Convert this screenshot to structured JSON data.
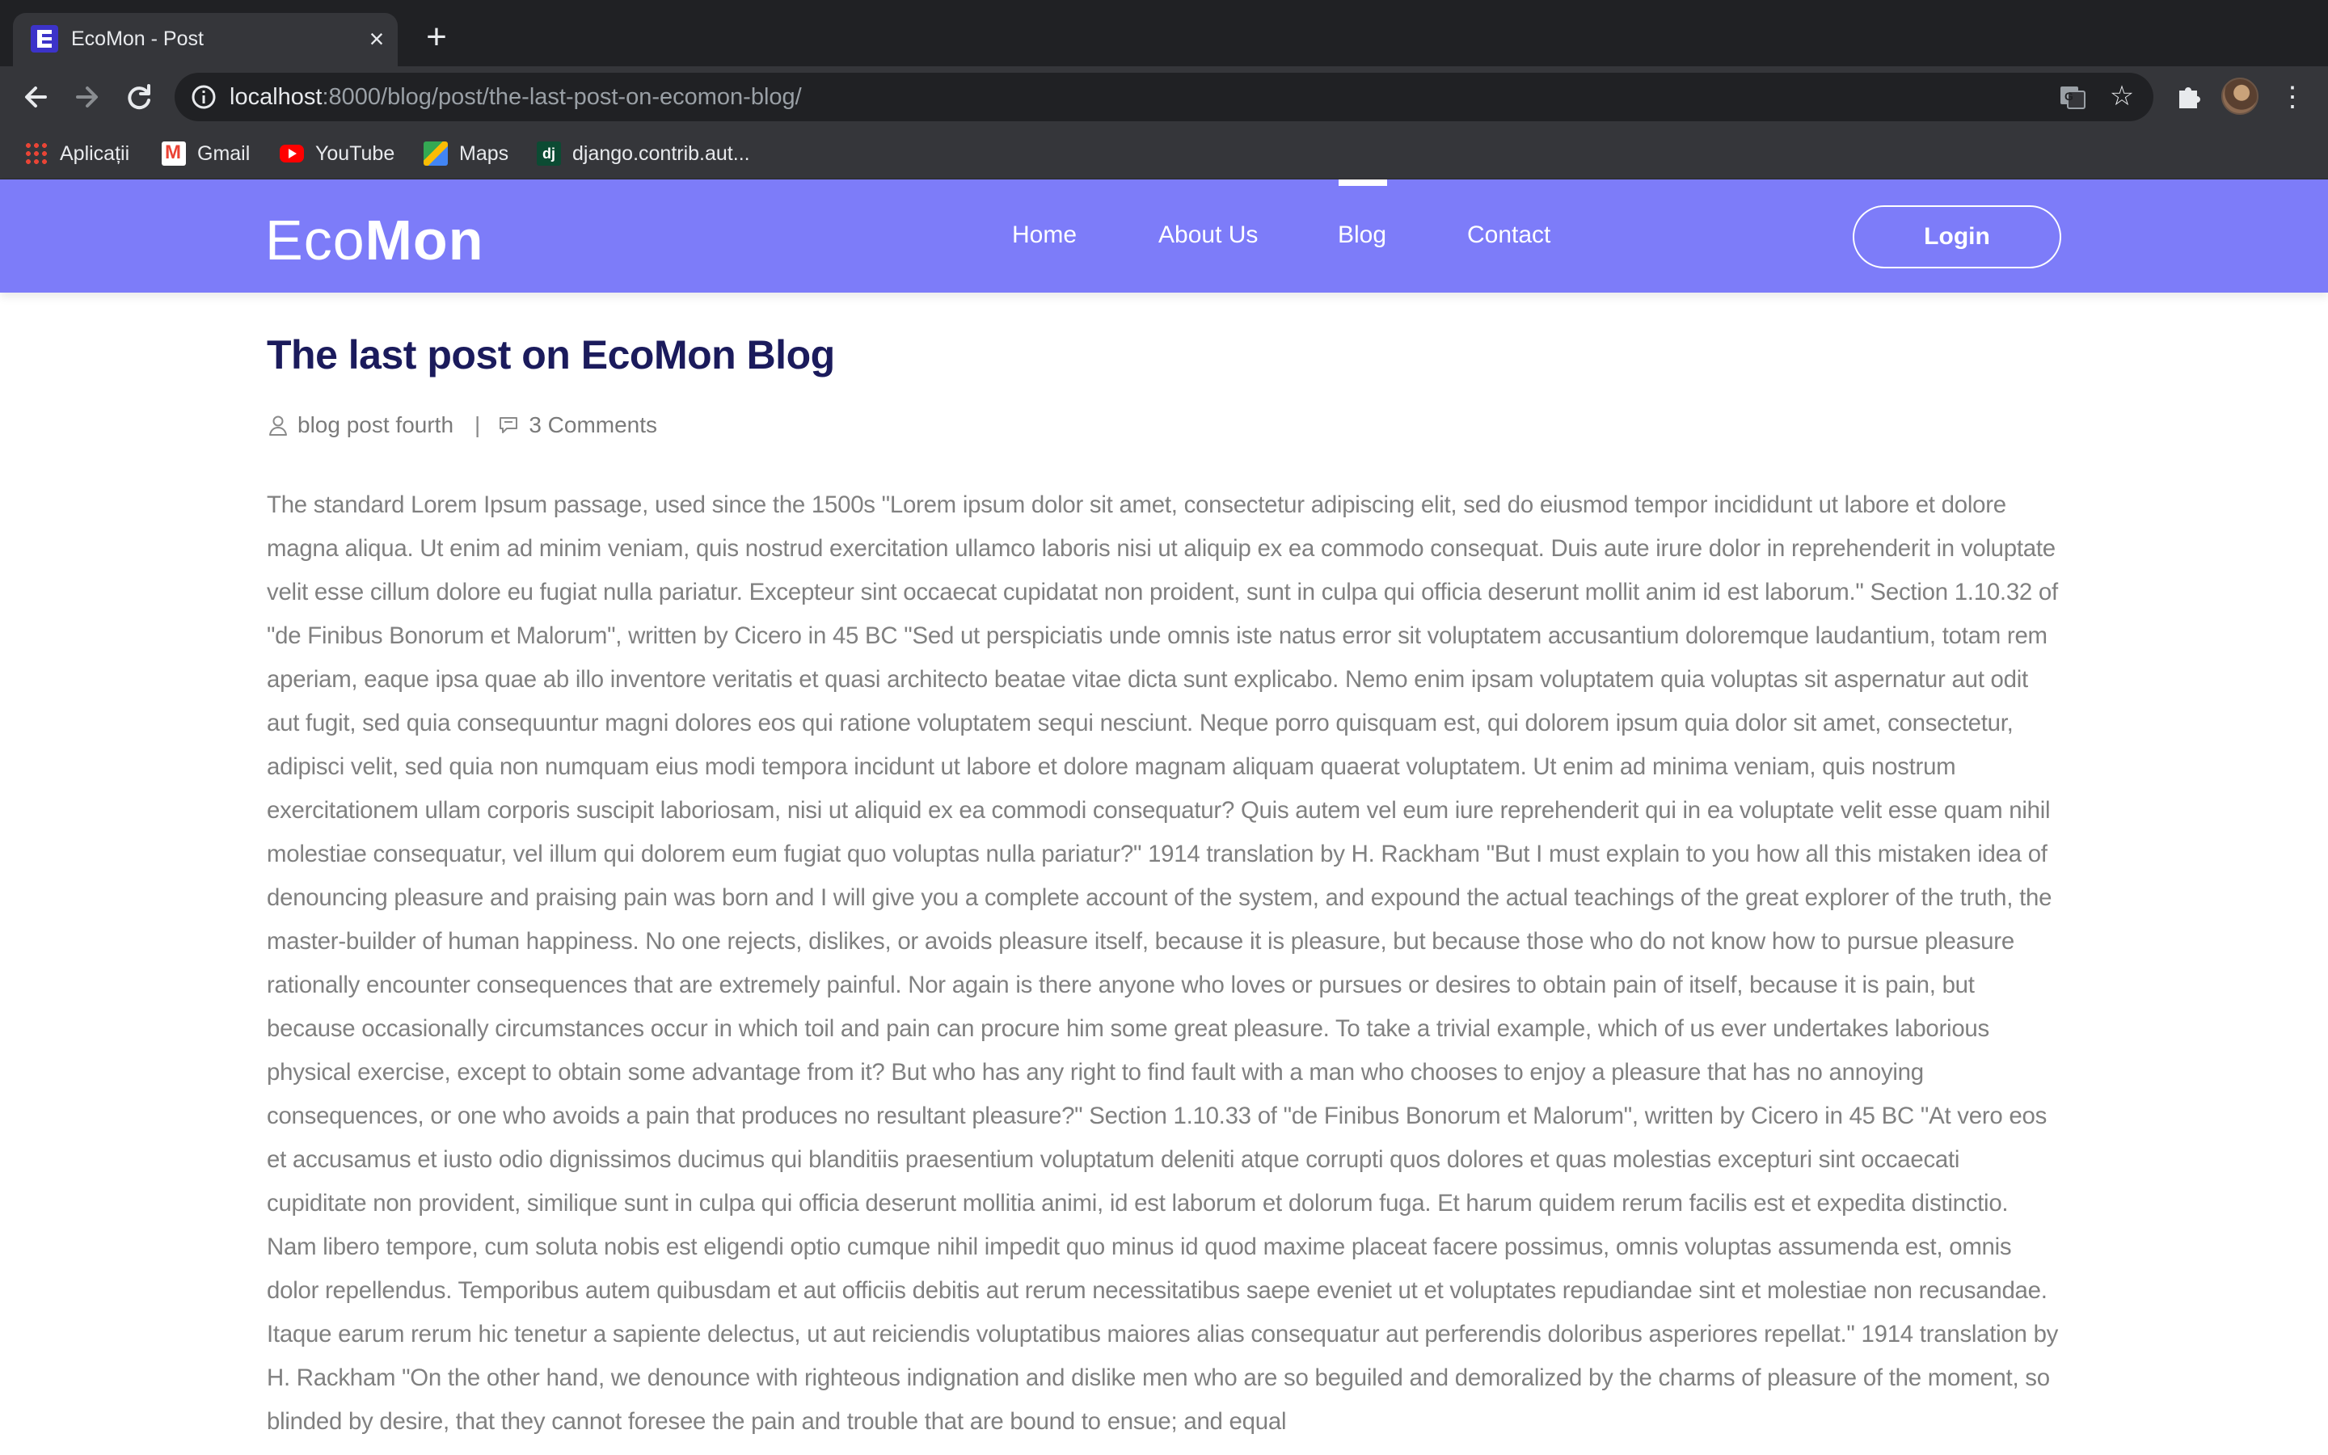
{
  "browser": {
    "tab_title": "EcoMon - Post",
    "url_host": "localhost",
    "url_rest": ":8000/blog/post/the-last-post-on-ecomon-blog/",
    "bookmarks": [
      "Aplicații",
      "Gmail",
      "YouTube",
      "Maps",
      "django.contrib.aut..."
    ]
  },
  "site": {
    "logo_part1": "Eco",
    "logo_part2": "Mon",
    "nav": [
      "Home",
      "About Us",
      "Blog",
      "Contact"
    ],
    "active_nav": "Blog",
    "login_label": "Login",
    "accent_color": "#7d7cf9"
  },
  "post": {
    "title": "The last post on EcoMon Blog",
    "author": "blog post fourth",
    "comments": "3 Comments",
    "body": "The standard Lorem Ipsum passage, used since the 1500s \"Lorem ipsum dolor sit amet, consectetur adipiscing elit, sed do eiusmod tempor incididunt ut labore et dolore magna aliqua. Ut enim ad minim veniam, quis nostrud exercitation ullamco laboris nisi ut aliquip ex ea commodo consequat. Duis aute irure dolor in reprehenderit in voluptate velit esse cillum dolore eu fugiat nulla pariatur. Excepteur sint occaecat cupidatat non proident, sunt in culpa qui officia deserunt mollit anim id est laborum.\" Section 1.10.32 of \"de Finibus Bonorum et Malorum\", written by Cicero in 45 BC \"Sed ut perspiciatis unde omnis iste natus error sit voluptatem accusantium doloremque laudantium, totam rem aperiam, eaque ipsa quae ab illo inventore veritatis et quasi architecto beatae vitae dicta sunt explicabo. Nemo enim ipsam voluptatem quia voluptas sit aspernatur aut odit aut fugit, sed quia consequuntur magni dolores eos qui ratione voluptatem sequi nesciunt. Neque porro quisquam est, qui dolorem ipsum quia dolor sit amet, consectetur, adipisci velit, sed quia non numquam eius modi tempora incidunt ut labore et dolore magnam aliquam quaerat voluptatem. Ut enim ad minima veniam, quis nostrum exercitationem ullam corporis suscipit laboriosam, nisi ut aliquid ex ea commodi consequatur? Quis autem vel eum iure reprehenderit qui in ea voluptate velit esse quam nihil molestiae consequatur, vel illum qui dolorem eum fugiat quo voluptas nulla pariatur?\" 1914 translation by H. Rackham \"But I must explain to you how all this mistaken idea of denouncing pleasure and praising pain was born and I will give you a complete account of the system, and expound the actual teachings of the great explorer of the truth, the master-builder of human happiness. No one rejects, dislikes, or avoids pleasure itself, because it is pleasure, but because those who do not know how to pursue pleasure rationally encounter consequences that are extremely painful. Nor again is there anyone who loves or pursues or desires to obtain pain of itself, because it is pain, but because occasionally circumstances occur in which toil and pain can procure him some great pleasure. To take a trivial example, which of us ever undertakes laborious physical exercise, except to obtain some advantage from it? But who has any right to find fault with a man who chooses to enjoy a pleasure that has no annoying consequences, or one who avoids a pain that produces no resultant pleasure?\" Section 1.10.33 of \"de Finibus Bonorum et Malorum\", written by Cicero in 45 BC \"At vero eos et accusamus et iusto odio dignissimos ducimus qui blanditiis praesentium voluptatum deleniti atque corrupti quos dolores et quas molestias excepturi sint occaecati cupiditate non provident, similique sunt in culpa qui officia deserunt mollitia animi, id est laborum et dolorum fuga. Et harum quidem rerum facilis est et expedita distinctio. Nam libero tempore, cum soluta nobis est eligendi optio cumque nihil impedit quo minus id quod maxime placeat facere possimus, omnis voluptas assumenda est, omnis dolor repellendus. Temporibus autem quibusdam et aut officiis debitis aut rerum necessitatibus saepe eveniet ut et voluptates repudiandae sint et molestiae non recusandae. Itaque earum rerum hic tenetur a sapiente delectus, ut aut reiciendis voluptatibus maiores alias consequatur aut perferendis doloribus asperiores repellat.\" 1914 translation by H. Rackham \"On the other hand, we denounce with righteous indignation and dislike men who are so beguiled and demoralized by the charms of pleasure of the moment, so blinded by desire, that they cannot foresee the pain and trouble that are bound to ensue; and equal"
  }
}
